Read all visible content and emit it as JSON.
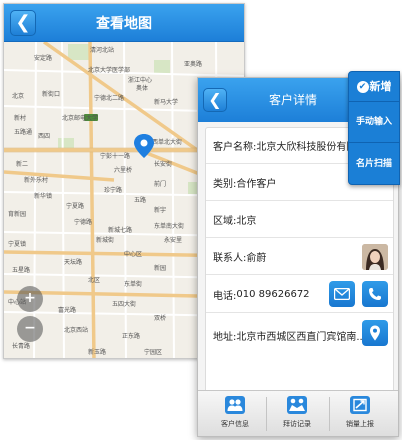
{
  "map_screen": {
    "title": "查看地图",
    "back_icon": "chevron-left-icon",
    "zoom_in_icon": "plus-icon",
    "zoom_out_icon": "minus-icon",
    "labels": [
      "清河北站",
      "亚奥路",
      "浙江中心",
      "奥体",
      "北京大学医学部",
      "安定路",
      "新街口",
      "北京",
      "宁德北二路",
      "北京邮电大学",
      "新马大学",
      "宁彭十一路",
      "西单北大街",
      "西四",
      "新村",
      "五路通",
      "新华镇",
      "六里桥",
      "长安街",
      "新二",
      "新外乐村",
      "宁夏路",
      "前门",
      "宁德路",
      "育新园",
      "珍宁路",
      "五路",
      "新宇",
      "新城七路",
      "东单南大街",
      "新城街",
      "宁夏镇",
      "永安里",
      "五星路",
      "中心区",
      "天坛路",
      "新园",
      "北区",
      "东单街",
      "中心站",
      "富光路",
      "五四大街",
      "双桥",
      "北京西站",
      "正东路",
      "长青路",
      "新玉路",
      "宁园区"
    ]
  },
  "detail_screen": {
    "title": "客户详情",
    "back_icon": "chevron-left-icon",
    "company_label": "客户名称:",
    "company_value": "北京大欣科技股份有限公",
    "type_label": "类别:",
    "type_value": "合作客户",
    "region_label": "区域:",
    "region_value": "北京",
    "contact_label": "联系人:",
    "contact_value": "俞蔚",
    "phone_label": "电话:",
    "phone_value": "010 89626672",
    "address_label": "地址:",
    "address_value": "北京市西城区西直门宾馆南..."
  },
  "side_menu": {
    "add_label": "新增",
    "manual_label": "手动输入",
    "card_scan_label": "名片扫描"
  },
  "footer_tabs": [
    {
      "label": "客户信息",
      "icon": "people-icon"
    },
    {
      "label": "拜访记录",
      "icon": "handshake-icon"
    },
    {
      "label": "销量上报",
      "icon": "report-icon"
    }
  ],
  "colors": {
    "header_blue": "#1d7fd8",
    "menu_blue": "#1b7fd6",
    "map_road_orange": "#f0c98a"
  }
}
